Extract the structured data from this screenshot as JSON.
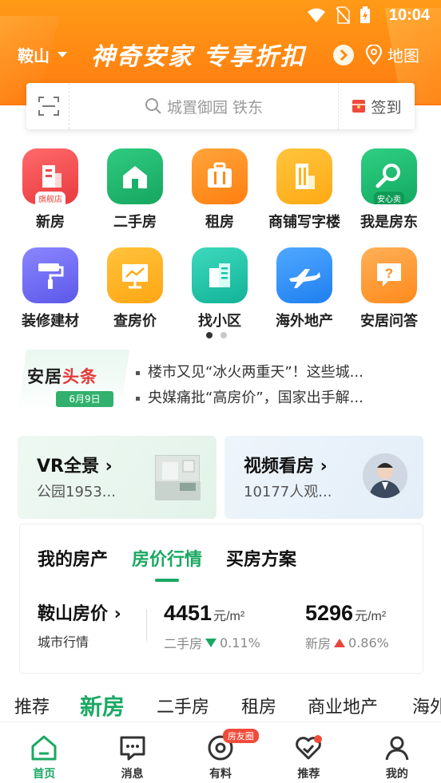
{
  "status_bar": {
    "time": "10:04"
  },
  "header": {
    "city": "鞍山",
    "slogan": "神奇安家 专享折扣",
    "map_label": "地图"
  },
  "search": {
    "placeholder": "城置御园 铁东",
    "checkin_label": "签到"
  },
  "grid": [
    {
      "label": "新房",
      "badge": "旗舰店",
      "icon": "new-house-icon",
      "color": "#f0474b"
    },
    {
      "label": "二手房",
      "badge": "",
      "icon": "second-hand-house-icon",
      "color": "#1bb06a"
    },
    {
      "label": "租房",
      "badge": "",
      "icon": "rent-icon",
      "color": "#ff8a18"
    },
    {
      "label": "商铺写字楼",
      "badge": "",
      "icon": "office-building-icon",
      "color": "#ffb21a"
    },
    {
      "label": "我是房东",
      "badge": "安心卖",
      "icon": "landlord-key-icon",
      "color": "#19b56b"
    },
    {
      "label": "装修建材",
      "badge": "",
      "icon": "paint-roller-icon",
      "color": "#6f6cf2"
    },
    {
      "label": "查房价",
      "badge": "",
      "icon": "price-chart-icon",
      "color": "#ffae1a"
    },
    {
      "label": "找小区",
      "badge": "",
      "icon": "community-icon",
      "color": "#19c2a6"
    },
    {
      "label": "海外地产",
      "badge": "",
      "icon": "airplane-icon",
      "color": "#2f8cf7"
    },
    {
      "label": "安居问答",
      "badge": "",
      "icon": "question-icon",
      "color": "#ff9a2a"
    }
  ],
  "pager": {
    "pages": 2,
    "current": 1
  },
  "news": {
    "logo_a": "安居",
    "logo_b": "头条",
    "date": "6月9日",
    "headlines": [
      "楼市又见“冰火两重天”！这些城...",
      "央媒痛批“高房价”，国家出手解..."
    ]
  },
  "cards": {
    "vr": {
      "title": "VR全景",
      "subtitle": "公园1953..."
    },
    "video": {
      "title": "视频看房",
      "subtitle": "10177人观..."
    }
  },
  "price_panel": {
    "tabs": [
      "我的房产",
      "房价行情",
      "买房方案"
    ],
    "active_tab": 1,
    "city_title": "鞍山房价",
    "city_sub": "城市行情",
    "second_hand": {
      "value": "4451",
      "unit": "元/m²",
      "label": "二手房",
      "change": "0.11%",
      "direction": "down"
    },
    "new_house": {
      "value": "5296",
      "unit": "元/m²",
      "label": "新房",
      "change": "0.86%",
      "direction": "up"
    }
  },
  "feed_tabs": [
    "推荐",
    "新房",
    "二手房",
    "租房",
    "商业地产",
    "海外"
  ],
  "feed_active": 1,
  "tabbar": [
    {
      "label": "首页",
      "icon": "home-icon"
    },
    {
      "label": "消息",
      "icon": "message-icon"
    },
    {
      "label": "有料",
      "icon": "discover-icon",
      "badge": "房友圈"
    },
    {
      "label": "推荐",
      "icon": "heart-check-icon"
    },
    {
      "label": "我的",
      "icon": "profile-icon"
    }
  ],
  "colors": {
    "brand_green": "#1aa862",
    "header_orange": "#ff8a14",
    "rise_red": "#e8453c"
  }
}
